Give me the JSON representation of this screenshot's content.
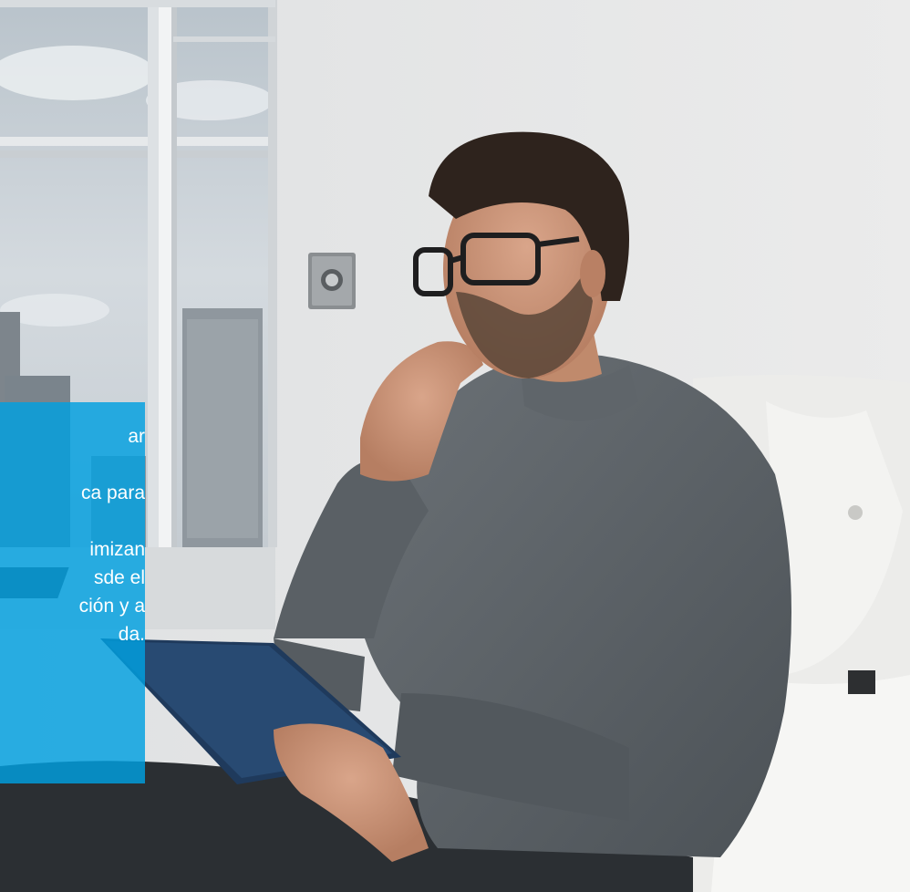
{
  "overlay": {
    "lines": [
      "ar",
      "",
      "ca para",
      "",
      "imizan",
      "sde el",
      "ción y a",
      "da."
    ]
  },
  "colors": {
    "overlay": "#00a0e0",
    "wall": "#e4e5e6",
    "sweater": "#5b6166"
  },
  "icons": {
    "wall_switch": "round-button-switch-icon"
  }
}
